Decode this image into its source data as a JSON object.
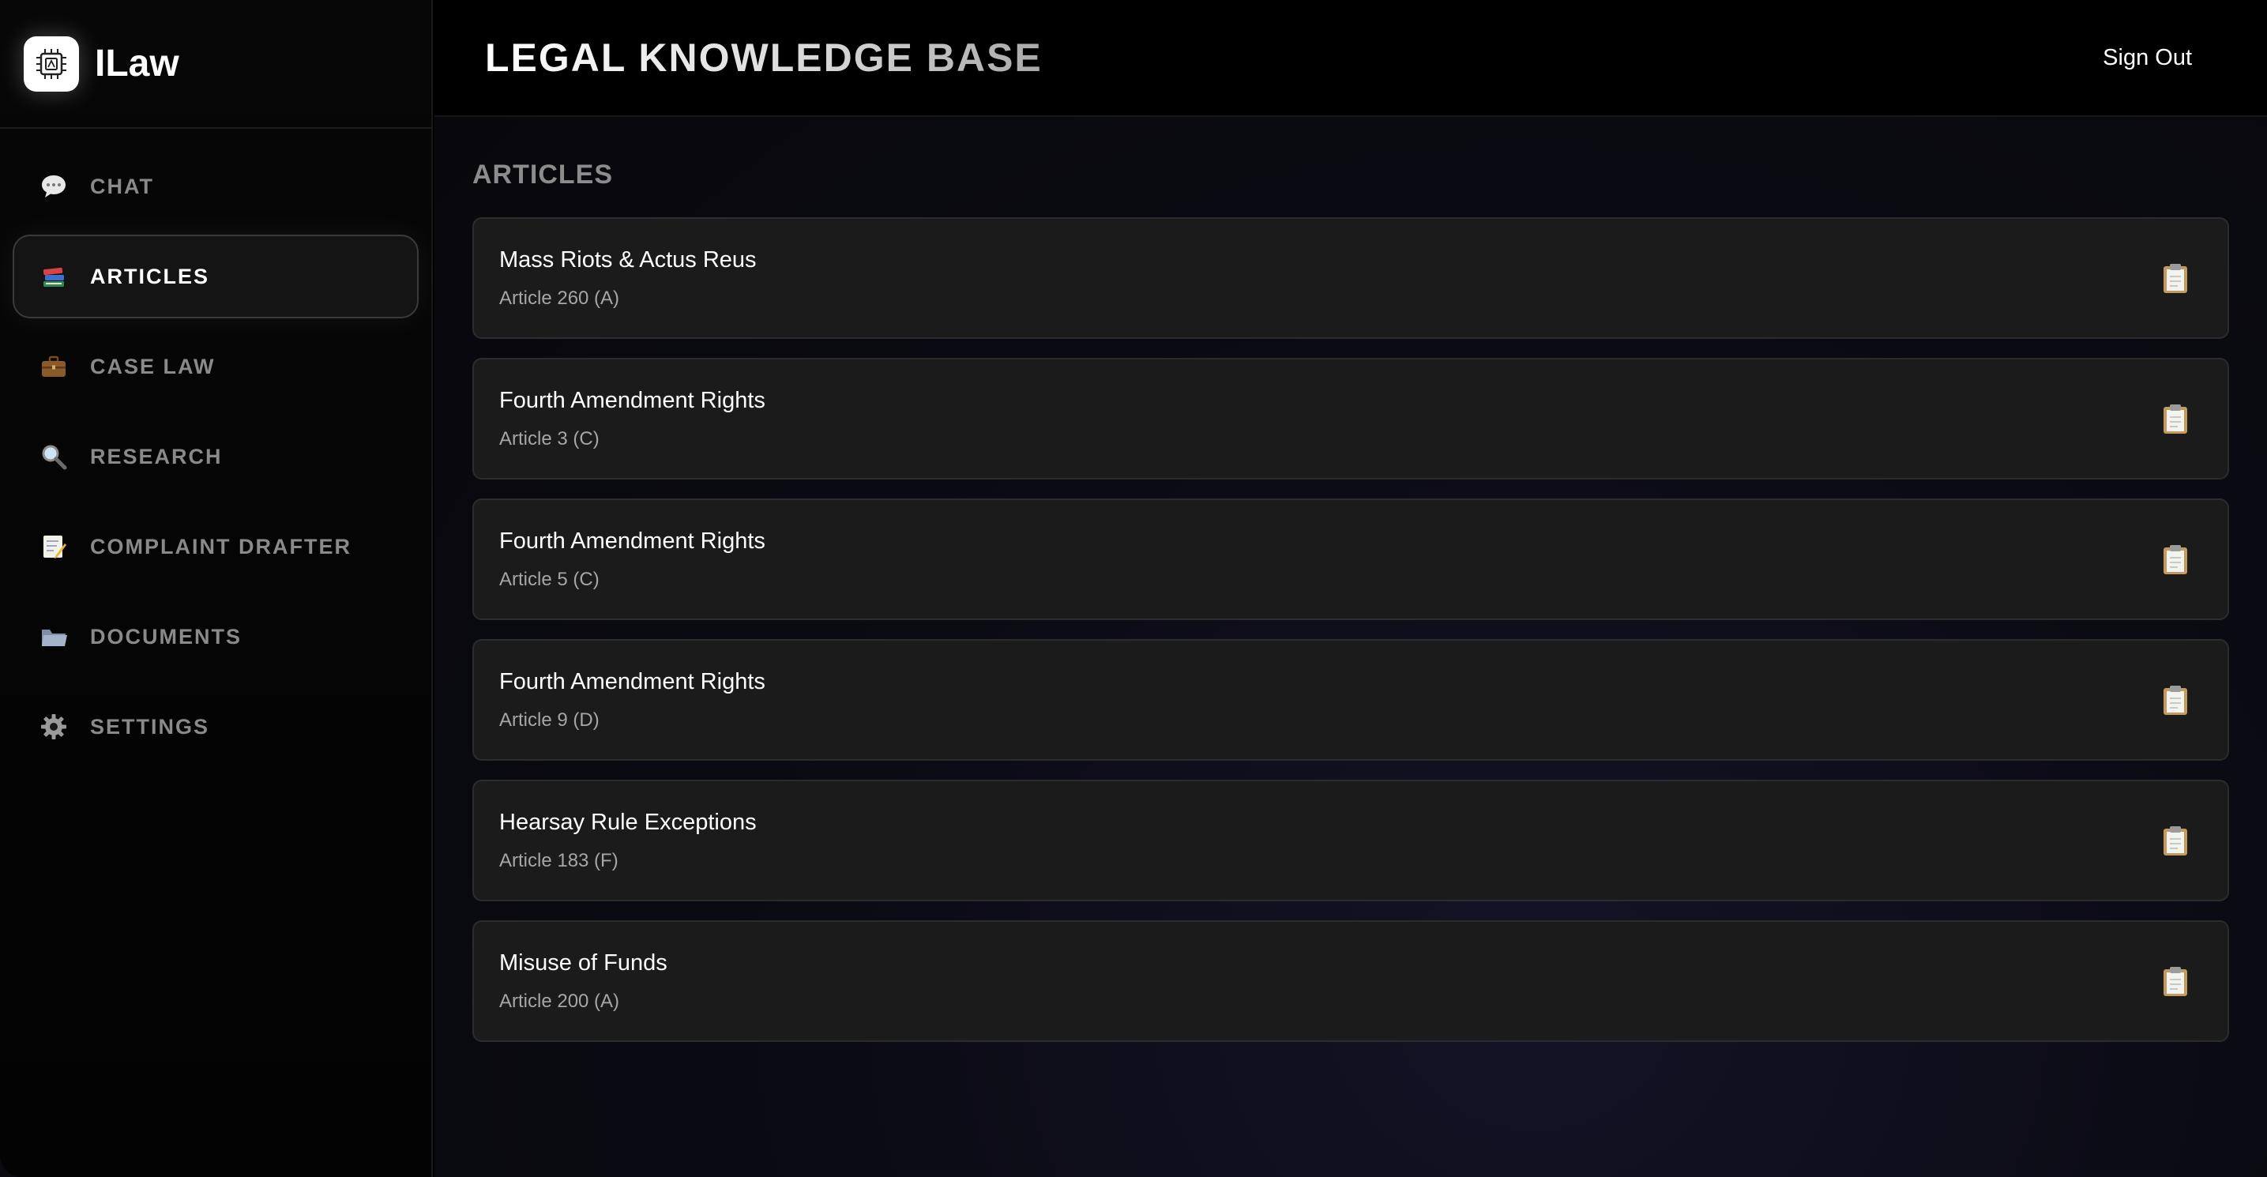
{
  "app": {
    "name": "ILaw"
  },
  "sidebar": {
    "items": [
      {
        "label": "CHAT",
        "icon": "speech-bubble-icon"
      },
      {
        "label": "ARTICLES",
        "icon": "books-icon",
        "active": true
      },
      {
        "label": "CASE LAW",
        "icon": "briefcase-icon"
      },
      {
        "label": "RESEARCH",
        "icon": "magnifier-icon"
      },
      {
        "label": "COMPLAINT DRAFTER",
        "icon": "memo-icon"
      },
      {
        "label": "DOCUMENTS",
        "icon": "folder-icon"
      },
      {
        "label": "SETTINGS",
        "icon": "gear-icon"
      }
    ]
  },
  "header": {
    "title": "LEGAL KNOWLEDGE BASE",
    "sign_out": "Sign Out"
  },
  "main": {
    "section_title": "ARTICLES",
    "articles": [
      {
        "title": "Mass Riots & Actus Reus",
        "ref": "Article 260 (A)"
      },
      {
        "title": "Fourth Amendment Rights",
        "ref": "Article 3 (C)"
      },
      {
        "title": "Fourth Amendment Rights",
        "ref": "Article 5 (C)"
      },
      {
        "title": "Fourth Amendment Rights",
        "ref": "Article 9 (D)"
      },
      {
        "title": "Hearsay Rule Exceptions",
        "ref": "Article 183 (F)"
      },
      {
        "title": "Misuse of Funds",
        "ref": "Article 200 (A)"
      }
    ]
  },
  "colors": {
    "background": "#000000",
    "card": "#1b1b1b",
    "muted_text": "#8a8a8a",
    "accent": "#ffffff"
  }
}
